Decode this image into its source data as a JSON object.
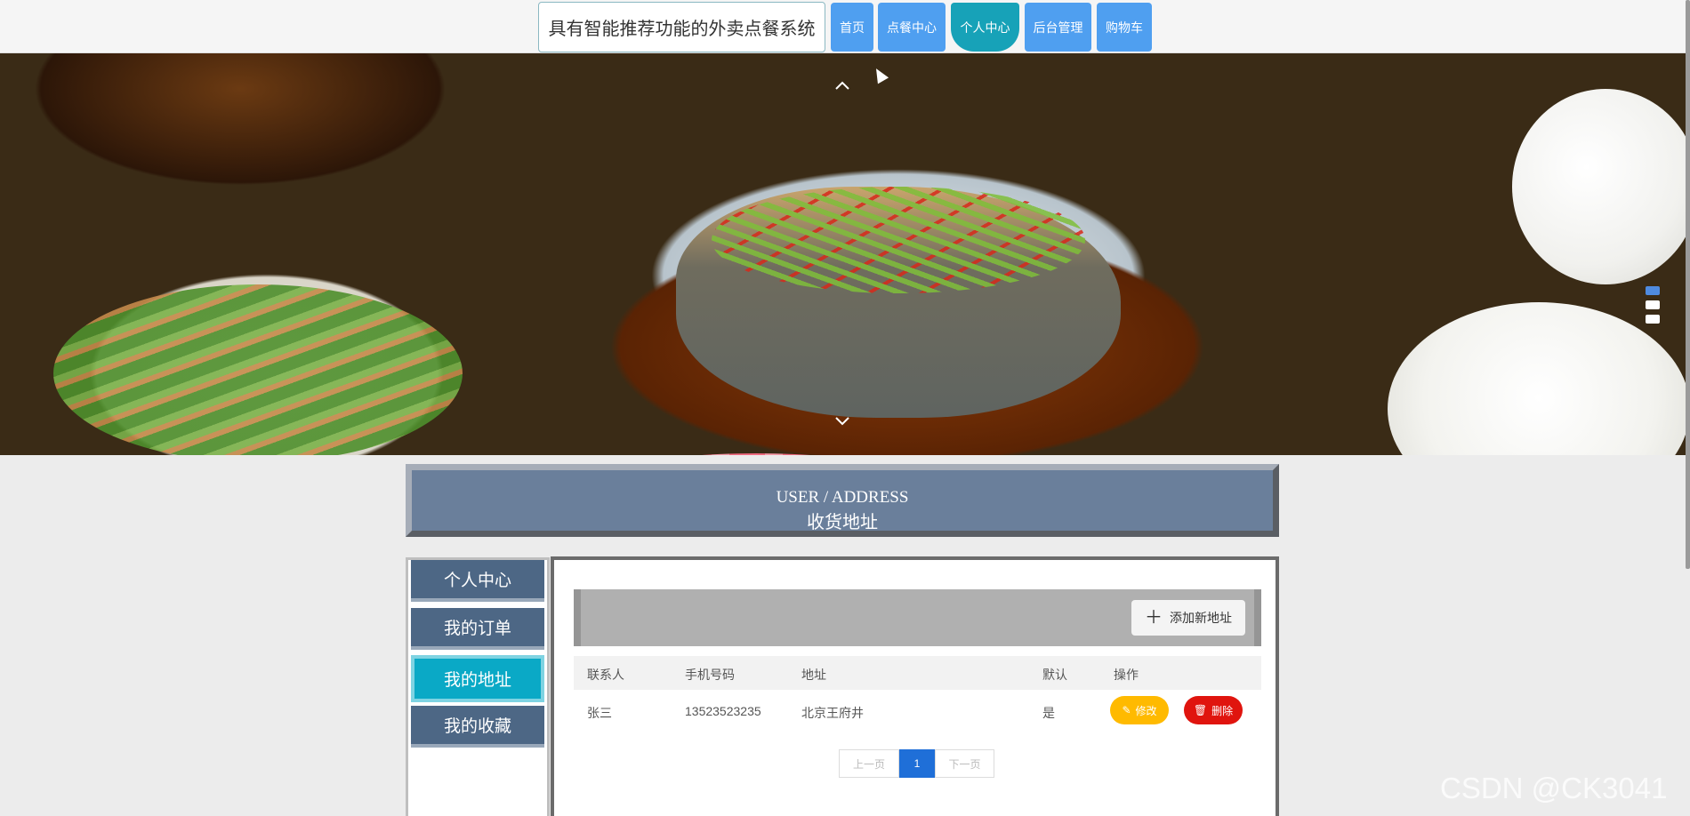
{
  "header": {
    "site_title": "具有智能推荐功能的外卖点餐系统",
    "nav": [
      "首页",
      "点餐中心",
      "个人中心",
      "后台管理",
      "购物车"
    ],
    "active_nav": "个人中心"
  },
  "banner": {
    "prev_icon": "chevron-up-icon",
    "next_icon": "chevron-down-icon",
    "slides": 3,
    "active_slide": 1
  },
  "page": {
    "title_en": "USER / ADDRESS",
    "title_zh": "收货地址"
  },
  "sidebar": {
    "items": [
      "个人中心",
      "我的订单",
      "我的地址",
      "我的收藏"
    ],
    "active": "我的地址"
  },
  "toolbar": {
    "add_label": "添加新地址",
    "add_icon": "plus-icon"
  },
  "table": {
    "columns": [
      "联系人",
      "手机号码",
      "地址",
      "默认",
      "操作"
    ],
    "rows": [
      {
        "contact": "张三",
        "phone": "13523523235",
        "address": "北京王府井",
        "default": "是",
        "edit_label": "修改",
        "delete_label": "删除"
      }
    ]
  },
  "pagination": {
    "prev": "上一页",
    "current": "1",
    "next": "下一页"
  },
  "watermark": "CSDN @CK3041",
  "colors": {
    "nav_button": "#4f9ff0",
    "nav_active": "#17a2b8",
    "sidebar_item": "#4d6785",
    "sidebar_active": "#0aa9c6",
    "edit_button": "#ffba00",
    "delete_button": "#e0140e",
    "page_active": "#1f6fd8"
  }
}
